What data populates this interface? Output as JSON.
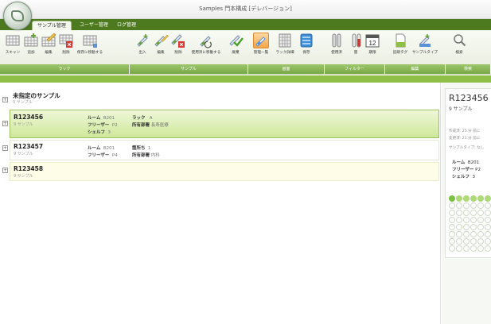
{
  "window": {
    "title": "Samples  門本構成 [デレバージョン]"
  },
  "tabs": [
    {
      "label": "サンプル管理",
      "active": true
    },
    {
      "label": "ユーザー管理",
      "active": false
    },
    {
      "label": "ログ管理",
      "active": false
    }
  ],
  "ribbon": {
    "buttons": [
      {
        "id": "scan",
        "label": "スキャン",
        "icon": "grid-icon"
      },
      {
        "id": "add",
        "label": "追加",
        "icon": "grid-add-icon"
      },
      {
        "id": "edit",
        "label": "編集",
        "icon": "grid-edit-icon"
      },
      {
        "id": "delete",
        "label": "削除",
        "icon": "grid-delete-icon"
      },
      {
        "id": "move-storage",
        "label": "保存に移動する",
        "icon": "grid-move-icon"
      },
      {
        "id": "out",
        "label": "出入",
        "icon": "test-tube-icon"
      },
      {
        "id": "edit2",
        "label": "編集",
        "icon": "test-tube-edit-icon"
      },
      {
        "id": "remove",
        "label": "削除",
        "icon": "test-tube-delete-icon"
      },
      {
        "id": "move-used",
        "label": "使用済に移動する",
        "icon": "test-tube-move-icon"
      },
      {
        "id": "discard",
        "label": "廃棄",
        "icon": "check-icon"
      },
      {
        "id": "sample-list",
        "label": "管理一覧",
        "icon": "list-tube-icon",
        "selected": true
      },
      {
        "id": "rack-detail",
        "label": "ラック詳細",
        "icon": "rack-icon"
      },
      {
        "id": "storage",
        "label": "保存",
        "icon": "storage-icon"
      },
      {
        "id": "used",
        "label": "使用済",
        "icon": "tube-filter-icon"
      },
      {
        "id": "amount",
        "label": "量",
        "icon": "tube-red-icon"
      },
      {
        "id": "period",
        "label": "期限",
        "icon": "calendar-icon",
        "day": "12"
      },
      {
        "id": "tag-add",
        "label": "追跡タグ",
        "icon": "document-icon"
      },
      {
        "id": "sample-type",
        "label": "サンプルタイプ",
        "icon": "tube-type-icon"
      },
      {
        "id": "search",
        "label": "検索",
        "icon": "search-icon"
      }
    ],
    "groups": [
      "ラック",
      "サンプル",
      "画面",
      "フィルター",
      "編集",
      "検索"
    ]
  },
  "list": {
    "group_header": {
      "title": "未指定のサンプル",
      "sub": "0 サンプル"
    },
    "rows": [
      {
        "id": "R123456",
        "sub": "9 サンプル",
        "room_label": "ルーム",
        "room_value": "B201",
        "freezer_label": "フリーザー",
        "freezer_value": "P2",
        "shelf_label": "シェルフ",
        "shelf_value": "3",
        "rack_label": "ラック",
        "rack_value": "A",
        "dept_label": "所有部署",
        "dept_value": "長寿医療"
      },
      {
        "id": "R123457",
        "sub": "9 サンプル",
        "room_label": "ルーム",
        "room_value": "B201",
        "freezer_label": "フリーザー",
        "freezer_value": "P4",
        "rack_label": "箇所ち",
        "rack_value": "1",
        "dept_label": "所有部署",
        "dept_value": "内科"
      },
      {
        "id": "R123458",
        "sub": "9 サンプル"
      }
    ]
  },
  "side": {
    "id": "R123456",
    "count": "9 サンプル",
    "created": "作成済: 25 分 前に",
    "updated": "変更済: 21 分 前に",
    "type": "サンプルタイプ: なし",
    "room_label": "ルーム",
    "room_value": "B201",
    "freezer_label": "フリーザー",
    "freezer_value": "P2",
    "shelf_label": "シェルフ",
    "shelf_value": "3"
  },
  "colors": {
    "accent": "#8fbf47",
    "brand_dark": "#4e7a1f",
    "selected_row": "#cfe89a",
    "dot_green": "#7cc242"
  }
}
